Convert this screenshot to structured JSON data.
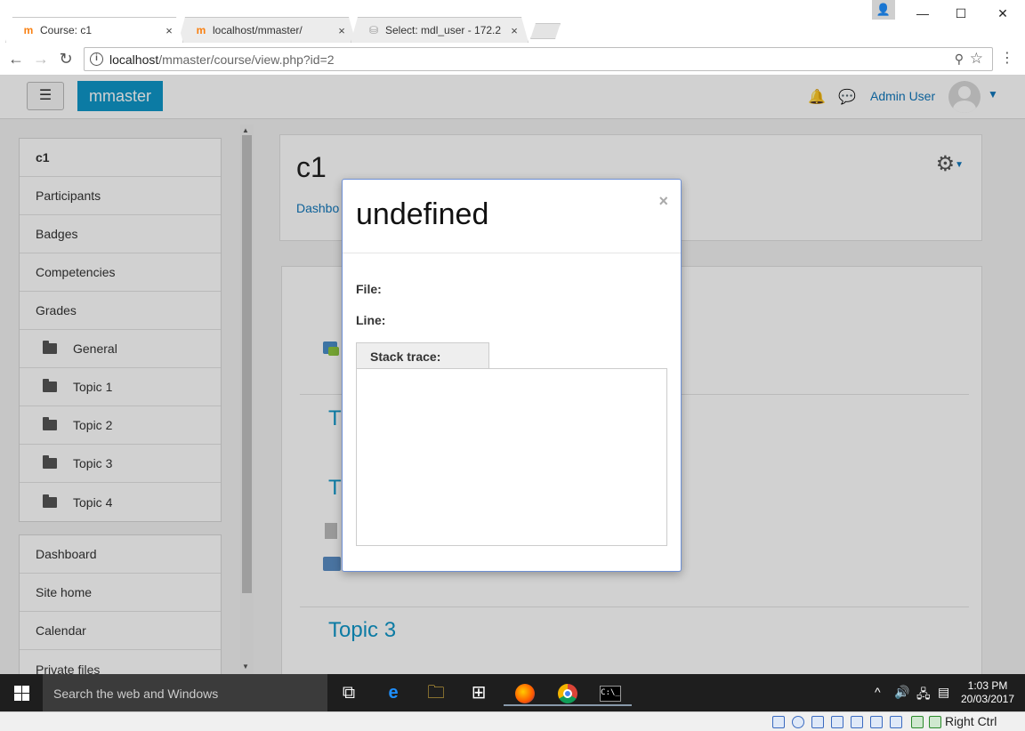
{
  "browser": {
    "tabs": [
      {
        "label": "Course: c1",
        "favicon": "moodle-icon",
        "active": true
      },
      {
        "label": "localhost/mmaster/",
        "favicon": "moodle-icon",
        "active": false
      },
      {
        "label": "Select: mdl_user - 172.2",
        "favicon": "database-icon",
        "active": false
      }
    ],
    "close_glyph": "×",
    "url_host": "localhost",
    "url_path": "/mmaster/course/view.php?id=2"
  },
  "navbar": {
    "menu_glyph": "☰",
    "brand": "mmaster",
    "user_name": "Admin User"
  },
  "sidebar": {
    "course_items": [
      {
        "label": "c1",
        "bold": true,
        "folder": false
      },
      {
        "label": "Participants",
        "bold": false,
        "folder": false
      },
      {
        "label": "Badges",
        "bold": false,
        "folder": false
      },
      {
        "label": "Competencies",
        "bold": false,
        "folder": false
      },
      {
        "label": "Grades",
        "bold": false,
        "folder": false
      },
      {
        "label": "General",
        "bold": false,
        "folder": true
      },
      {
        "label": "Topic 1",
        "bold": false,
        "folder": true
      },
      {
        "label": "Topic 2",
        "bold": false,
        "folder": true
      },
      {
        "label": "Topic 3",
        "bold": false,
        "folder": true
      },
      {
        "label": "Topic 4",
        "bold": false,
        "folder": true
      }
    ],
    "site_items": [
      {
        "label": "Dashboard"
      },
      {
        "label": "Site home"
      },
      {
        "label": "Calendar"
      },
      {
        "label": "Private files"
      }
    ]
  },
  "course": {
    "title": "c1",
    "breadcrumb": "Dashbo",
    "topic_a": "T",
    "topic_b": "T",
    "topic_3": "Topic 3"
  },
  "modal": {
    "title": "undefined",
    "close_glyph": "×",
    "file_label": "File:",
    "line_label": "Line:",
    "stack_trace_label": "Stack trace:"
  },
  "taskbar": {
    "search_placeholder": "Search the web and Windows",
    "time": "1:03 PM",
    "date": "20/03/2017",
    "host_key": "Right Ctrl"
  },
  "colors": {
    "brand": "#0f96c8",
    "link": "#1177bb",
    "modal_border": "#6d8fd4"
  }
}
